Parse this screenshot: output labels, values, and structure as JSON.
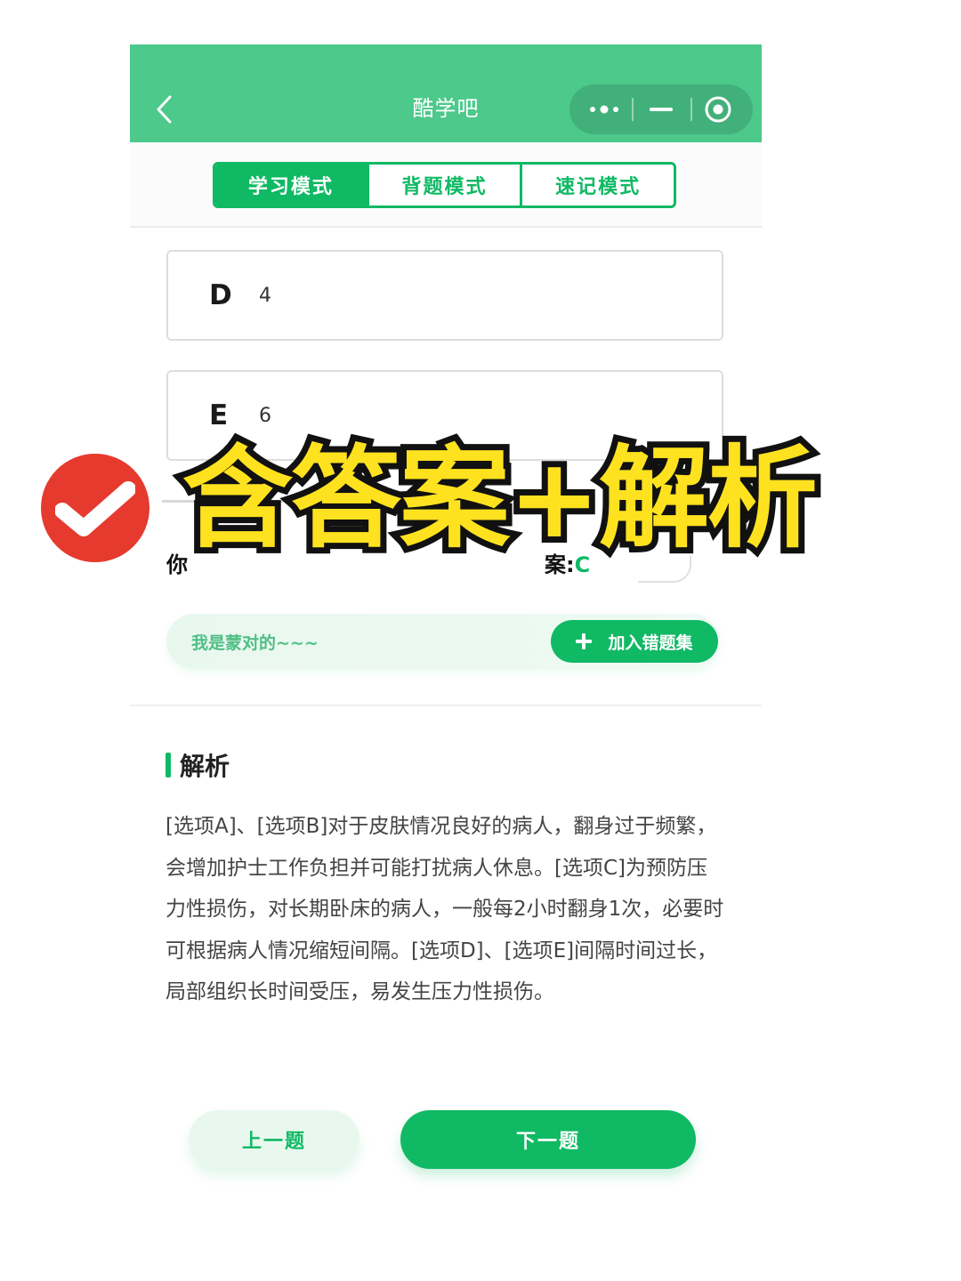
{
  "header": {
    "title": "酷学吧",
    "accent_color": "#4cc98b"
  },
  "tabs": [
    {
      "label": "学习模式",
      "active": true
    },
    {
      "label": "背题模式",
      "active": false
    },
    {
      "label": "速记模式",
      "active": false
    }
  ],
  "options": [
    {
      "letter": "D",
      "text": "4"
    },
    {
      "letter": "E",
      "text": "6"
    }
  ],
  "answer": {
    "your_label": "你",
    "correct_label": "案:",
    "correct_value": "C"
  },
  "note": {
    "text": "我是蒙对的~~~",
    "add_label": "加入错题集"
  },
  "analysis": {
    "title": "解析",
    "body": "[选项A]、[选项B]对于皮肤情况良好的病人，翻身过于频繁，会增加护士工作负担并可能打扰病人休息。[选项C]为预防压力性损伤，对长期卧床的病人，一般每2小时翻身1次，必要时可根据病人情况缩短间隔。[选项D]、[选项E]间隔时间过长，局部组织长时间受压，易发生压力性损伤。"
  },
  "nav": {
    "prev_label": "上一题",
    "next_label": "下一题"
  },
  "overlay": {
    "text": "含答案+解析"
  },
  "brand_green": "#10b964"
}
